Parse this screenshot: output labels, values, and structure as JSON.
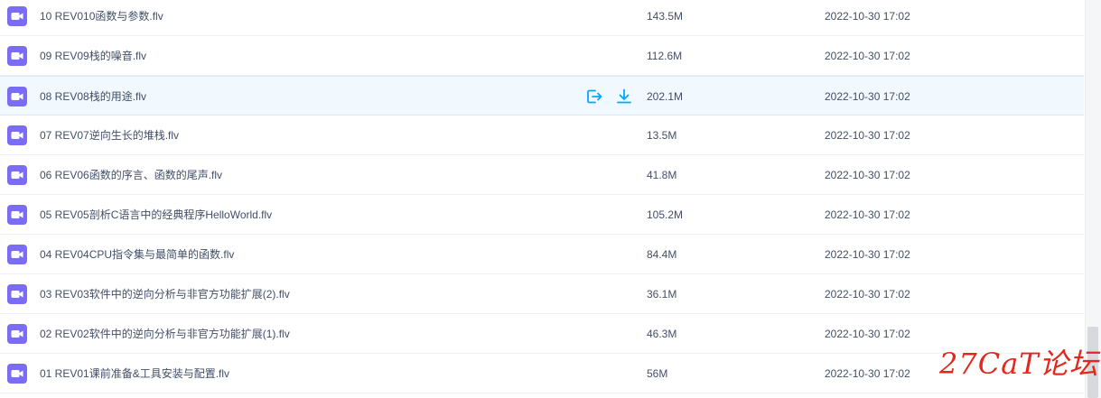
{
  "files": [
    {
      "name": "10 REV010函数与参数.flv",
      "size": "143.5M",
      "date": "2022-10-30 17:02",
      "icon": "video-file-icon"
    },
    {
      "name": "09 REV09栈的噪音.flv",
      "size": "112.6M",
      "date": "2022-10-30 17:02",
      "icon": "video-file-icon"
    },
    {
      "name": "08 REV08栈的用途.flv",
      "size": "202.1M",
      "date": "2022-10-30 17:02",
      "icon": "video-file-icon"
    },
    {
      "name": "07 REV07逆向生长的堆栈.flv",
      "size": "13.5M",
      "date": "2022-10-30 17:02",
      "icon": "video-file-icon"
    },
    {
      "name": "06 REV06函数的序言、函数的尾声.flv",
      "size": "41.8M",
      "date": "2022-10-30 17:02",
      "icon": "video-file-icon"
    },
    {
      "name": "05 REV05剖析C语言中的经典程序HelloWorld.flv",
      "size": "105.2M",
      "date": "2022-10-30 17:02",
      "icon": "video-file-icon"
    },
    {
      "name": "04 REV04CPU指令集与最简单的函数.flv",
      "size": "84.4M",
      "date": "2022-10-30 17:02",
      "icon": "video-file-icon"
    },
    {
      "name": "03 REV03软件中的逆向分析与非官方功能扩展(2).flv",
      "size": "36.1M",
      "date": "2022-10-30 17:02",
      "icon": "video-file-icon"
    },
    {
      "name": "02 REV02软件中的逆向分析与非官方功能扩展(1).flv",
      "size": "46.3M",
      "date": "2022-10-30 17:02",
      "icon": "video-file-icon"
    },
    {
      "name": "01 REV01课前准备&工具安装与配置.flv",
      "size": "56M",
      "date": "2022-10-30 17:02",
      "icon": "video-file-icon"
    }
  ],
  "hover_row": {
    "actions": [
      {
        "icon": "share-export-icon"
      },
      {
        "icon": "download-icon"
      }
    ]
  },
  "watermark": {
    "text": "27CaT论坛"
  },
  "colors": {
    "icon_purple": "#7b6cf6",
    "accent_blue": "#06a7ff",
    "text": "#424e67",
    "hover_bg": "#f1f8fe",
    "watermark_red": "#e4271d"
  }
}
